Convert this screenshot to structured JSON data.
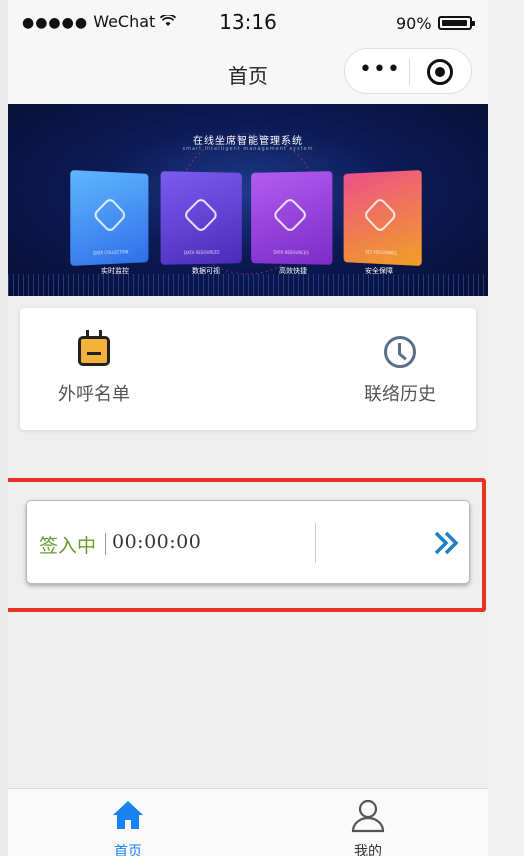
{
  "status_bar": {
    "carrier": "WeChat",
    "time": "13:16",
    "battery": "90%"
  },
  "nav": {
    "title": "首页",
    "more_icon": "more-dots-icon",
    "close_icon": "target-circle-icon"
  },
  "banner": {
    "title": "在线坐席智能管理系统",
    "subtitle": "smart intelligent management system",
    "panels": [
      {
        "en": "DATA COLLECTION",
        "label": "实时监控",
        "color": "#3d8ef0"
      },
      {
        "en": "DATA RESOURCES",
        "label": "数据可视",
        "color": "#6b40d8"
      },
      {
        "en": "DATA RESOURCES",
        "label": "高效快捷",
        "color": "#9a3fd8"
      },
      {
        "en": "KEY PERSONNEL",
        "label": "安全保障",
        "color": "#e0622e"
      }
    ]
  },
  "menu": {
    "items": [
      {
        "label": "外呼名单",
        "icon": "calendar-list-icon"
      },
      {
        "label": "联络历史",
        "icon": "clock-history-icon"
      }
    ]
  },
  "signin": {
    "status": "签入中",
    "timer": "00:00:00",
    "action_icon": "double-chevron-right-icon"
  },
  "tabbar": {
    "items": [
      {
        "label": "首页",
        "icon": "home-icon",
        "active": true,
        "color": "#1a82f0"
      },
      {
        "label": "我的",
        "icon": "user-icon",
        "active": false,
        "color": "#333333"
      }
    ]
  }
}
